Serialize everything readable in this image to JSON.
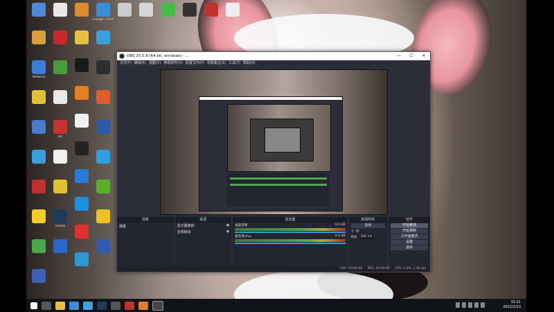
{
  "desktop": {
    "icons": [
      {
        "label": "",
        "color": "#4d8ad8"
      },
      {
        "label": "",
        "color": "#e8e8e8"
      },
      {
        "label": "",
        "color": "#e08a2a"
      },
      {
        "label": "Google Chrome",
        "color": "#3a8dd6"
      },
      {
        "label": "",
        "color": "#cccccc"
      },
      {
        "label": "",
        "color": "#d6d6d6"
      },
      {
        "label": "",
        "color": "#43c043"
      },
      {
        "label": "",
        "color": "#333333"
      },
      {
        "label": "",
        "color": "#c23030"
      },
      {
        "label": "",
        "color": "#eeeeee"
      }
    ],
    "col1": [
      {
        "label": "",
        "color": "#d9a03a"
      },
      {
        "label": "Network",
        "color": "#3b7dd8"
      },
      {
        "label": "",
        "color": "#e0c23a"
      },
      {
        "label": "",
        "color": "#4a7bd0"
      },
      {
        "label": "",
        "color": "#38a0dd"
      },
      {
        "label": "",
        "color": "#c22f2f"
      },
      {
        "label": "",
        "color": "#f4cc2a"
      },
      {
        "label": "",
        "color": "#4aa84a"
      },
      {
        "label": "",
        "color": "#3b5fb5"
      }
    ],
    "col2": [
      {
        "label": "",
        "color": "#c9262d"
      },
      {
        "label": "",
        "color": "#4b9c3a"
      },
      {
        "label": "",
        "color": "#e8e8e8"
      },
      {
        "label": "64",
        "color": "#c73333"
      },
      {
        "label": "",
        "color": "#f0f0f0"
      },
      {
        "label": "",
        "color": "#e0c030"
      },
      {
        "label": "Steam",
        "color": "#1d3b5a"
      },
      {
        "label": "",
        "color": "#2b66c9"
      }
    ],
    "col3": [
      {
        "label": "",
        "color": "#e8c040"
      },
      {
        "label": "",
        "color": "#1a1a1a"
      },
      {
        "label": "",
        "color": "#e67e22"
      },
      {
        "label": "",
        "color": "#f0f0f0"
      },
      {
        "label": "",
        "color": "#222222"
      },
      {
        "label": "",
        "color": "#2a7bd8"
      },
      {
        "label": "",
        "color": "#1d8fe0"
      },
      {
        "label": "",
        "color": "#e03030"
      },
      {
        "label": "",
        "color": "#2a9bd8"
      }
    ],
    "col4": [
      {
        "label": "",
        "color": "#38a0dd"
      },
      {
        "label": "",
        "color": "#2e2e2e"
      },
      {
        "label": "",
        "color": "#e05a2a"
      },
      {
        "label": "",
        "color": "#2b5aa8"
      },
      {
        "label": "",
        "color": "#2da0e0"
      },
      {
        "label": "",
        "color": "#5bb02a"
      },
      {
        "label": "",
        "color": "#f0c020"
      },
      {
        "label": "",
        "color": "#2e5bb0"
      }
    ]
  },
  "obs": {
    "title": "OBS 25.0.8 (64 bit, windows) - ...",
    "win_min": "—",
    "win_max": "☐",
    "win_close": "✕",
    "menu": [
      "文件(F)",
      "编辑(E)",
      "视图(V)",
      "停靠部件(D)",
      "配置文件(P)",
      "场景集合(S)",
      "工具(T)",
      "帮助(H)"
    ],
    "panels": {
      "scenes_header": "场景",
      "sources_header": "来源",
      "mixer_header": "混音器",
      "transitions_header": "转场特效",
      "controls_header": "控件",
      "scene_item": "场景",
      "source_1": "显示器捕获",
      "source_2": "音频输出",
      "mixer_1": "桌面音频",
      "mixer_1_db": "0.0 dB",
      "mixer_2": "麦克风/Aux",
      "mixer_2_db": "0.0 dB",
      "transition_value": "淡出",
      "duration_label": "时长",
      "duration_value": "300 ms",
      "btn_stream": "开始推流",
      "btn_record": "开始录制",
      "btn_studio": "工作室模式",
      "btn_settings": "设置",
      "btn_exit": "退出",
      "status_live": "LIVE: 00:00:00",
      "status_rec": "REC: 00:00:00",
      "status_cpu": "CPU: 1.0%, 1.00 fps"
    }
  },
  "taskbar": {
    "time": "15:21",
    "date": "2022/2/13"
  }
}
